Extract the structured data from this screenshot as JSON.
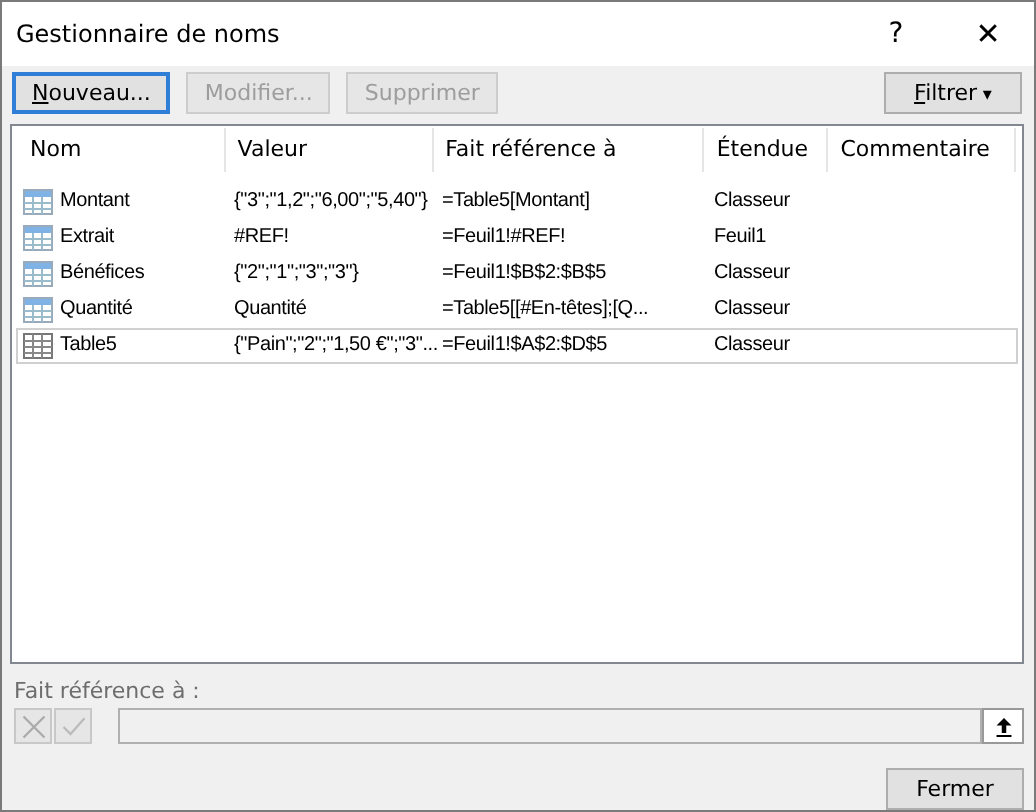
{
  "window": {
    "title": "Gestionnaire de noms",
    "help": "?",
    "close": "✕"
  },
  "toolbar": [
    {
      "label": "Nouveau...",
      "disabled": false,
      "mnemonic": true,
      "focused": true
    },
    {
      "label": "Modifier...",
      "disabled": true,
      "mnemonic": false,
      "focused": false
    },
    {
      "label": "Supprimer",
      "disabled": true,
      "mnemonic": false,
      "focused": false
    }
  ],
  "filter": {
    "label": "Filtrer",
    "mnemonic": true,
    "caret": "▾"
  },
  "table": {
    "columns": [
      "Nom",
      "Valeur",
      "Fait référence à",
      "Étendue",
      "Commentaire"
    ],
    "rows": [
      {
        "kind": "name",
        "selected": false,
        "cells": [
          "Montant",
          "{\"3\";\"1,2\";\"6,00\";\"5,40\"}",
          "=Table5[Montant]",
          "Classeur"
        ]
      },
      {
        "kind": "name",
        "selected": false,
        "cells": [
          "Extrait",
          "#REF!",
          "=Feuil1!#REF!",
          "Feuil1"
        ]
      },
      {
        "kind": "name",
        "selected": false,
        "cells": [
          "Bénéfices",
          "{\"2\";\"1\";\"3\";\"3\"}",
          "=Feuil1!$B$2:$B$5",
          "Classeur"
        ]
      },
      {
        "kind": "name",
        "selected": false,
        "cells": [
          "Quantité",
          "Quantité",
          "=Table5[[#En-têtes];[Q...",
          "Classeur"
        ]
      },
      {
        "kind": "table",
        "selected": true,
        "cells": [
          "Table5",
          "{\"Pain\";\"2\";\"1,50 €\";\"3\"...",
          "=Feuil1!$A$2:$D$5",
          "Classeur"
        ]
      }
    ]
  },
  "refers_to": {
    "label": "Fait référence à :",
    "disabled": true
  },
  "footer_button": "Fermer"
}
